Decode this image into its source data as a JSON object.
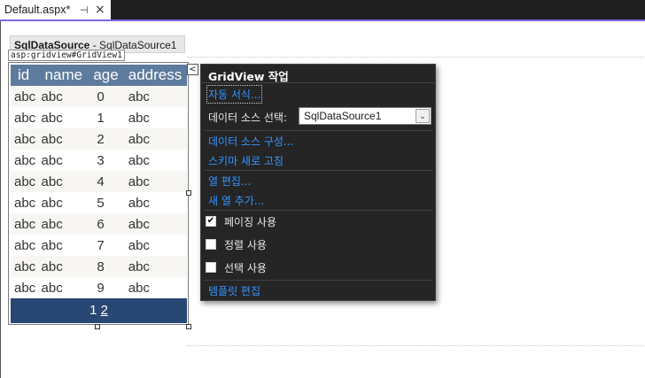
{
  "document_tab": {
    "title": "Default.aspx*",
    "pin_glyph": "⊣",
    "close_glyph": "×"
  },
  "datasource_control": {
    "name": "SqlDataSource",
    "separator": " - ",
    "id": "SqlDataSource1"
  },
  "gridview": {
    "tag_label": "asp:gridview#GridView1",
    "columns": [
      "id",
      "name",
      "age",
      "address"
    ],
    "rows": [
      [
        "abc",
        "abc",
        "0",
        "abc"
      ],
      [
        "abc",
        "abc",
        "1",
        "abc"
      ],
      [
        "abc",
        "abc",
        "2",
        "abc"
      ],
      [
        "abc",
        "abc",
        "3",
        "abc"
      ],
      [
        "abc",
        "abc",
        "4",
        "abc"
      ],
      [
        "abc",
        "abc",
        "5",
        "abc"
      ],
      [
        "abc",
        "abc",
        "6",
        "abc"
      ],
      [
        "abc",
        "abc",
        "7",
        "abc"
      ],
      [
        "abc",
        "abc",
        "8",
        "abc"
      ],
      [
        "abc",
        "abc",
        "9",
        "abc"
      ]
    ],
    "pager": {
      "current": "1",
      "link": "2"
    },
    "colors": {
      "header": "#5d7b9d",
      "pager": "#284775",
      "alt_row": "#f7f6f3"
    }
  },
  "smart_tag": {
    "glyph": "<"
  },
  "tasks_panel": {
    "title": "GridView 작업",
    "auto_format": "자동 서식...",
    "choose_datasource_label": "데이터 소스 선택:",
    "choose_datasource_value": "SqlDataSource1",
    "dropdown_glyph": "⌄",
    "configure_datasource": "데이터 소스 구성...",
    "refresh_schema": "스키마 새로 고침",
    "edit_columns": "열 편집...",
    "add_column": "새 열 추가...",
    "options": [
      {
        "label": "페이징 사용",
        "checked": true,
        "check_glyph": "✔"
      },
      {
        "label": "정렬 사용",
        "checked": false,
        "check_glyph": ""
      },
      {
        "label": "선택 사용",
        "checked": false,
        "check_glyph": ""
      }
    ],
    "edit_templates": "템플릿 편집",
    "link_color": "#3794ff"
  }
}
